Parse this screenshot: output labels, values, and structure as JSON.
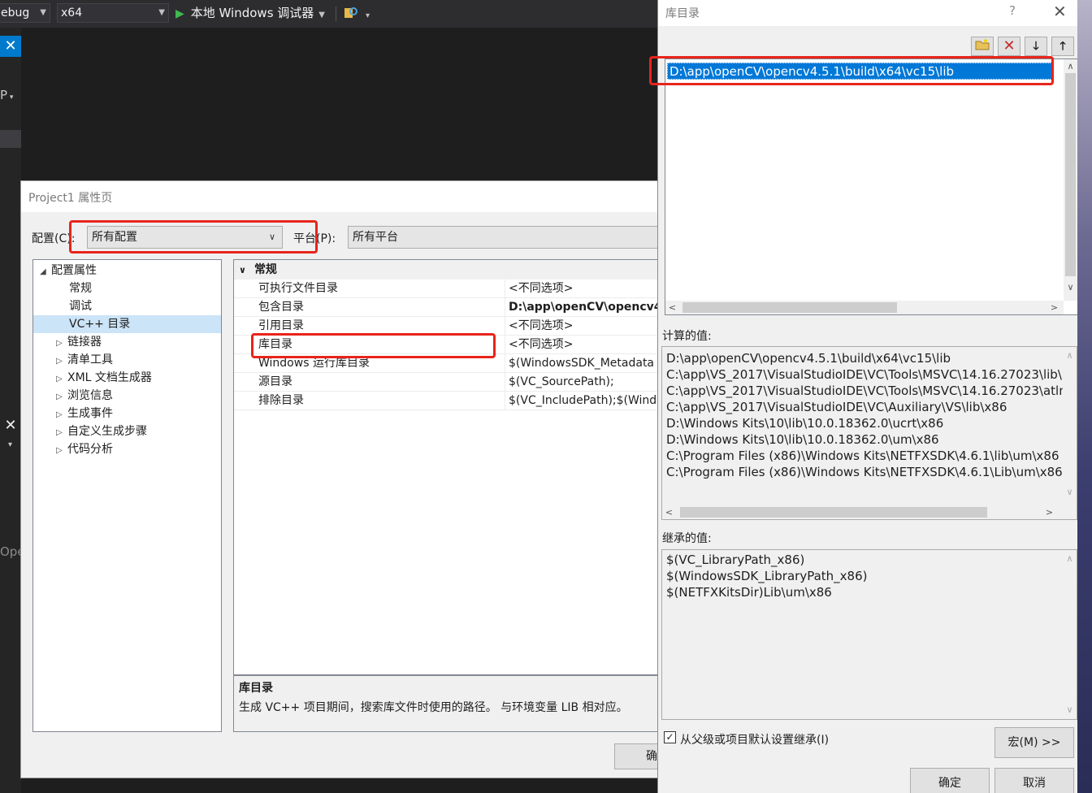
{
  "toolbar": {
    "config_fragment": "ebug",
    "platform_value": "x64",
    "run_label": "本地 Windows 调试器"
  },
  "left_fragments": {
    "frag1": "P",
    "frag2": "Ope"
  },
  "prop_dialog": {
    "title": "Project1 属性页",
    "config_label": "配置(C):",
    "config_value": "所有配置",
    "platform_label": "平台(P):",
    "platform_value": "所有平台",
    "tree": {
      "root": "配置属性",
      "items": [
        "常规",
        "调试",
        "VC++ 目录",
        "链接器",
        "清单工具",
        "XML 文档生成器",
        "浏览信息",
        "生成事件",
        "自定义生成步骤",
        "代码分析"
      ]
    },
    "grid": {
      "category": "常规",
      "rows": [
        {
          "name": "可执行文件目录",
          "value": "<不同选项>"
        },
        {
          "name": "包含目录",
          "value": "D:\\app\\openCV\\opencv4"
        },
        {
          "name": "引用目录",
          "value": "<不同选项>"
        },
        {
          "name": "库目录",
          "value": "<不同选项>"
        },
        {
          "name": "Windows 运行库目录",
          "value": "$(WindowsSDK_Metadata"
        },
        {
          "name": "源目录",
          "value": "$(VC_SourcePath);"
        },
        {
          "name": "排除目录",
          "value": "$(VC_IncludePath);$(Winde"
        }
      ]
    },
    "description": {
      "title": "库目录",
      "text": "生成 VC++ 项目期间，搜索库文件时使用的路径。 与环境变量 LIB 相对应。"
    },
    "ok_label": "确"
  },
  "lib_dialog": {
    "title": "库目录",
    "help": "?",
    "close": "✕",
    "entries": [
      "D:\\app\\openCV\\opencv4.5.1\\build\\x64\\vc15\\lib"
    ],
    "calc_label": "计算的值:",
    "calc_values": [
      "D:\\app\\openCV\\opencv4.5.1\\build\\x64\\vc15\\lib",
      "C:\\app\\VS_2017\\VisualStudioIDE\\VC\\Tools\\MSVC\\14.16.27023\\lib\\",
      "C:\\app\\VS_2017\\VisualStudioIDE\\VC\\Tools\\MSVC\\14.16.27023\\atlm",
      "C:\\app\\VS_2017\\VisualStudioIDE\\VC\\Auxiliary\\VS\\lib\\x86",
      "D:\\Windows Kits\\10\\lib\\10.0.18362.0\\ucrt\\x86",
      "D:\\Windows Kits\\10\\lib\\10.0.18362.0\\um\\x86",
      "C:\\Program Files (x86)\\Windows Kits\\NETFXSDK\\4.6.1\\lib\\um\\x86",
      "C:\\Program Files (x86)\\Windows Kits\\NETFXSDK\\4.6.1\\Lib\\um\\x86"
    ],
    "inherit_label": "继承的值:",
    "inherit_values": [
      "$(VC_LibraryPath_x86)",
      "$(WindowsSDK_LibraryPath_x86)",
      "$(NETFXKitsDir)Lib\\um\\x86"
    ],
    "inherit_checkbox_label": "从父级或项目默认设置继承(I)",
    "inherit_checked": true,
    "macro_button": "宏(M) >>",
    "ok_button": "确定",
    "cancel_button": "取消"
  },
  "colors": {
    "highlight": "#e8241b",
    "selection": "#0078d7",
    "vs_dark": "#2d2d30"
  }
}
